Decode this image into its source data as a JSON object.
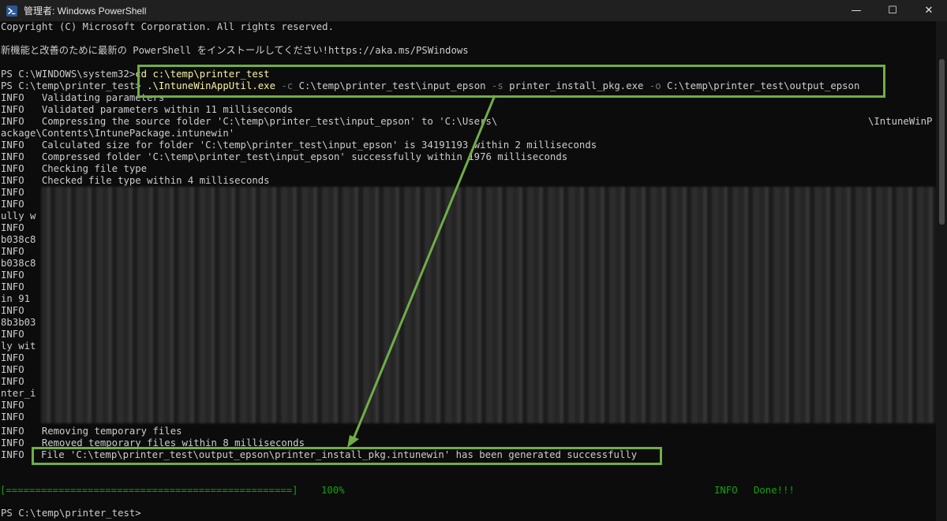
{
  "window": {
    "title": "管理者: Windows PowerShell",
    "controls": {
      "minimize": "—",
      "maximize": "☐",
      "close": "✕"
    }
  },
  "terminal": {
    "copyright": "Copyright (C) Microsoft Corporation. All rights reserved.",
    "install_notice": "新機能と改善のために最新の PowerShell をインストールしてください!https://aka.ms/PSWindows",
    "cmd1_prompt": "PS C:\\WINDOWS\\system32>",
    "cmd1": "cd c:\\temp\\printer_test",
    "cmd2_prompt": "PS C:\\temp\\printer_test>",
    "cmd2_exe": ".\\IntuneWinAppUtil.exe",
    "cmd2_c": "-c",
    "cmd2_src": "C:\\temp\\printer_test\\input_epson",
    "cmd2_s": "-s",
    "cmd2_setup": "printer_install_pkg.exe",
    "cmd2_o": "-o",
    "cmd2_out": "C:\\temp\\printer_test\\output_epson",
    "info_lines": [
      "INFO   Validating parameters",
      "INFO   Validated parameters within 11 milliseconds",
      "INFO   Compressing the source folder 'C:\\temp\\printer_test\\input_epson' to 'C:\\Users\\",
      "\\IntuneWinP",
      "ackage\\Contents\\IntunePackage.intunewin'",
      "INFO   Calculated size for folder 'C:\\temp\\printer_test\\input_epson' is 34191193 within 2 milliseconds",
      "INFO   Compressed folder 'C:\\temp\\printer_test\\input_epson' successfully within 1976 milliseconds",
      "INFO   Checking file type",
      "INFO   Checked file type within 4 milliseconds"
    ],
    "left_margin_lines": [
      "INFO",
      "INFO",
      "ully w",
      "INFO",
      "b038c8",
      "INFO",
      "b038c8",
      "INFO",
      "INFO",
      "in 91",
      "INFO",
      "8b3b03",
      "INFO",
      "ly wit",
      "INFO",
      "INFO",
      "INFO",
      "nter_i",
      "INFO",
      "INFO"
    ],
    "removing": "INFO   Removing temporary files",
    "removed": "INFO   Removed temporary files within 8 milliseconds",
    "final_info": "INFO",
    "final_file": "File 'C:\\temp\\printer_test\\output_epson\\printer_install_pkg.intunewin' has been generated successfully",
    "progress_bar": "[=================================================]",
    "progress_pct": "100%",
    "done_info": "INFO",
    "done_text": "Done!!!",
    "final_prompt": "PS C:\\temp\\printer_test>"
  }
}
